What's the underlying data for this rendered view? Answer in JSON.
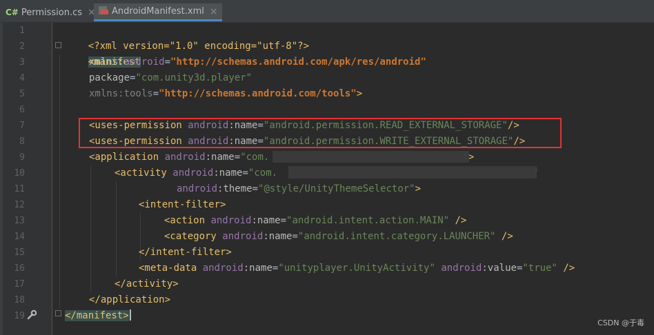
{
  "tabs": [
    {
      "icon": "C#",
      "label": "Permission.cs",
      "close": "×",
      "active": false
    },
    {
      "icon": "xml",
      "label": "AndroidManifest.xml",
      "close": "×",
      "active": true
    }
  ],
  "line_numbers": [
    "1",
    "2",
    "3",
    "4",
    "5",
    "6",
    "7",
    "8",
    "9",
    "10",
    "11",
    "12",
    "13",
    "14",
    "15",
    "16",
    "17",
    "18",
    "19"
  ],
  "code": {
    "l1": {
      "pi": "<?xml version=\"1.0\" encoding=\"utf-8\"?>"
    },
    "l2": {
      "tag": "<manifest"
    },
    "l3": {
      "attr": "xmlns:",
      "ns": "android",
      "eq": "=",
      "val": "\"http://schemas.android.com/apk/res/android\""
    },
    "l4": {
      "attr": "package",
      "eq": "=",
      "val": "\"com.unity3d.player\""
    },
    "l5": {
      "attr": "xmlns:tools",
      "eq": "=",
      "val": "\"http://schemas.android.com/tools\"",
      "end": ">"
    },
    "l7": {
      "tag": "<uses-permission ",
      "ns": "android",
      "attr": ":name",
      "eq": "=",
      "val": "\"android.permission.READ_EXTERNAL_STORAGE\"",
      "end": "/>"
    },
    "l8": {
      "tag": "<uses-permission ",
      "ns": "android",
      "attr": ":name",
      "eq": "=",
      "val": "\"android.permission.WRITE_EXTERNAL_STORAGE\"",
      "end": "/>"
    },
    "l9": {
      "tag": "<application ",
      "ns": "android",
      "attr": ":name",
      "eq": "=",
      "val": "\"com.",
      "val_end": "\"",
      "end": ">"
    },
    "l10": {
      "tag": "<activity ",
      "ns": "android",
      "attr": ":name",
      "eq": "=",
      "val": "\"com.",
      "val_end": "\""
    },
    "l11": {
      "ns": "android",
      "attr": ":theme",
      "eq": "=",
      "val": "\"@style/UnityThemeSelector\"",
      "end": ">"
    },
    "l12": {
      "tag": "<intent-filter>"
    },
    "l13": {
      "tag": "<action ",
      "ns": "android",
      "attr": ":name",
      "eq": "=",
      "val": "\"android.intent.action.MAIN\"",
      "end": " />"
    },
    "l14": {
      "tag": "<category ",
      "ns": "android",
      "attr": ":name",
      "eq": "=",
      "val": "\"android.intent.category.LAUNCHER\"",
      "end": " />"
    },
    "l15": {
      "tag": "</intent-filter>"
    },
    "l16": {
      "tag": "<meta-data ",
      "ns": "android",
      "attr": ":name",
      "eq": "=",
      "val": "\"unityplayer.UnityActivity\"",
      "ns2": "android",
      "attr2": ":value",
      "eq2": "=",
      "val2": "\"true\"",
      "end": " />"
    },
    "l17": {
      "tag": "</activity>"
    },
    "l18": {
      "tag": "</application>"
    },
    "l19": {
      "tag": "</manifest>"
    }
  },
  "watermark": "CSDN @于毒",
  "colors": {
    "highlight_box": "#e53333",
    "tag": "#e8bf6a",
    "value": "#6a8759",
    "url": "#cc7832",
    "namespace": "#9876aa"
  },
  "icons": {
    "gutter_marker": "wrench-icon"
  }
}
